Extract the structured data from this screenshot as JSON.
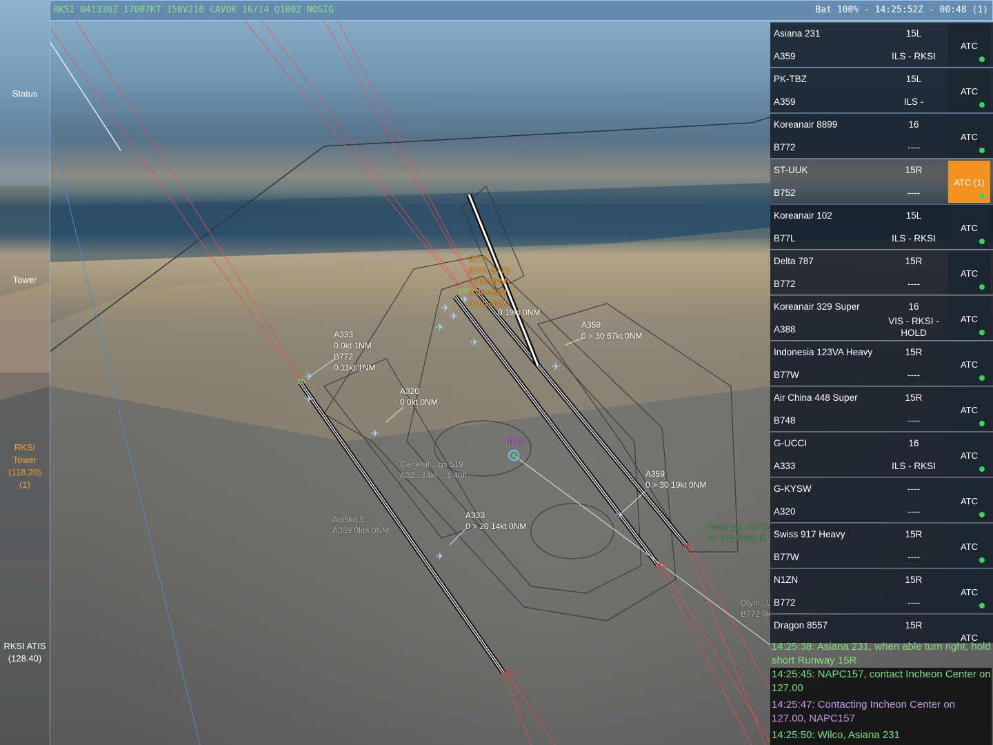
{
  "topbar": {
    "metar": "RKSI 041330Z 17007KT 150V210 CAVOK 16/14 Q1002 NOSIG",
    "status": "Bat 100% - 14:25:52Z - 00:48 (1)"
  },
  "left_panel": {
    "status": "Status",
    "tower": "Tower",
    "rksi_tower": [
      "RKSI",
      "Tower",
      "(118.20)",
      "(1)"
    ],
    "atis": [
      "RKSI ATIS",
      "(128.40)"
    ]
  },
  "strips": [
    {
      "callsign": "Asiana 231",
      "type": "A359",
      "runway": "15L",
      "route": "ILS - RKSI",
      "atc": "ATC",
      "highlight": false,
      "dot": true
    },
    {
      "callsign": "PK-TBZ",
      "type": "A359",
      "runway": "15L",
      "route": "ILS -",
      "atc": "ATC",
      "highlight": false,
      "dot": true
    },
    {
      "callsign": "Koreanair 8899",
      "type": "B772",
      "runway": "16",
      "route": "----",
      "atc": "ATC",
      "highlight": false,
      "dot": true
    },
    {
      "callsign": "ST-UUK",
      "type": "B752",
      "runway": "15R",
      "route": "----",
      "atc": "ATC (1)",
      "highlight": true,
      "dot": true
    },
    {
      "callsign": "Koreanair 102",
      "type": "B77L",
      "runway": "15L",
      "route": "ILS - RKSI",
      "atc": "ATC",
      "highlight": false,
      "dot": true
    },
    {
      "callsign": "Delta 787",
      "type": "B772",
      "runway": "15R",
      "route": "----",
      "atc": "ATC",
      "highlight": false,
      "dot": true
    },
    {
      "callsign": "Koreanair 329 Super",
      "type": "A388",
      "runway": "16",
      "route": "VIS - RKSI - HOLD",
      "route_lines": [
        "VIS - RKSI -",
        "HOLD"
      ],
      "atc": "ATC",
      "highlight": false,
      "dot": true
    },
    {
      "callsign": "Indonesia 123VA Heavy",
      "type": "B77W",
      "runway": "15R",
      "route": "----",
      "atc": "ATC",
      "highlight": false,
      "dot": true
    },
    {
      "callsign": "Air China 448 Super",
      "type": "B748",
      "runway": "15R",
      "route": "----",
      "atc": "ATC",
      "highlight": false,
      "dot": true
    },
    {
      "callsign": "G-UCCI",
      "type": "A333",
      "runway": "16",
      "route": "ILS - RKSI",
      "atc": "ATC",
      "highlight": false,
      "dot": true
    },
    {
      "callsign": "G-KYSW",
      "type": "A320",
      "runway": "----",
      "route": "----",
      "atc": "ATC",
      "highlight": false,
      "dot": true
    },
    {
      "callsign": "Swiss 917 Heavy",
      "type": "B77W",
      "runway": "15R",
      "route": "----",
      "atc": "ATC",
      "highlight": false,
      "dot": true
    },
    {
      "callsign": "N1ZN",
      "type": "B772",
      "runway": "15R",
      "route": "----",
      "atc": "ATC",
      "highlight": false,
      "dot": true
    },
    {
      "callsign": "Dragon 8557",
      "type": "",
      "runway": "15R",
      "route": "",
      "atc": "ATC",
      "highlight": false,
      "dot": false
    }
  ],
  "comms": [
    {
      "text": "14:25:38: Asiana 231, when able turn right, hold short Runway 15R",
      "color": "green"
    },
    {
      "text": "14:25:45: NAPC157, contact Incheon Center on 127.00",
      "color": "green"
    },
    {
      "text": "14:25:47: Contacting Incheon Center on 127.00, NAPC157",
      "color": "purple"
    },
    {
      "text": "14:25:50: Wilco, Asiana 231",
      "color": "green"
    }
  ],
  "map_labels": [
    {
      "lines": [
        "A333",
        "0 0kt 1NM",
        "B772",
        "0 11kt 1NM"
      ],
      "style": "normal"
    },
    {
      "lines": [
        "A320",
        "0 0kt 0NM"
      ],
      "style": "normal"
    },
    {
      "lines": [
        "A359",
        "0 > 30 67kt 0NM"
      ],
      "style": "normal"
    },
    {
      "lines": [
        "0 19kt 0NM"
      ],
      "style": "normal"
    },
    {
      "lines": [
        "B772",
        "B77L B772",
        "0 0kt 0NM",
        "0 0kt 0NM",
        "0 0kt 0NM"
      ],
      "style": "orange"
    },
    {
      "lines": [
        "A359",
        "0 > 30 19kt 0NM"
      ],
      "style": "normal"
    },
    {
      "lines": [
        "A333",
        "0 > 20 14kt 0NM"
      ],
      "style": "normal"
    },
    {
      "lines": [
        "General ...gs 519",
        "A32...14kt ...1 40ft"
      ],
      "style": "faded"
    },
    {
      "lines": [
        "Alaska 5...",
        "A359 0kts 0NM"
      ],
      "style": "faded"
    },
    {
      "lines": [
        "Koreanair 700 Super",
        "48 0kts 0NM 4ft"
      ],
      "style": "green"
    },
    {
      "lines": [
        "Olym...UA",
        "B772 0kts 0NM 3ft"
      ],
      "style": "faded"
    }
  ],
  "airport_marker": "RKSI",
  "runway_labels": [
    "16",
    "15R",
    "15L",
    "16",
    "15R",
    "15L"
  ],
  "colors": {
    "accent": "#9ec7ee",
    "metar": "#8be08b",
    "atc_highlight": "#f5921e",
    "status_dot": "#39d35a",
    "comms_green": "#7ee07e",
    "comms_purple": "#c79ae0",
    "tower_label": "#f0a030"
  }
}
